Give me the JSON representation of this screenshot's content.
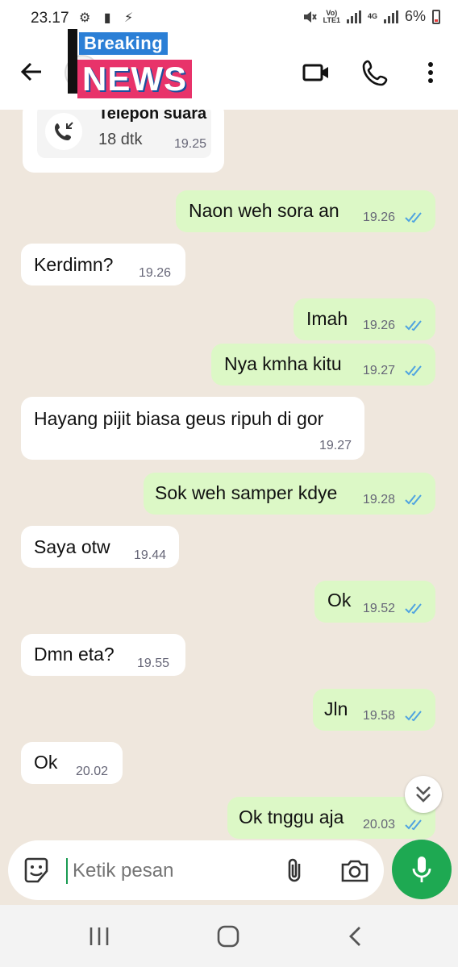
{
  "status_bar": {
    "time": "23.17",
    "left_icons": "⚙ ▮ ⚡",
    "network_lte": "LTE1",
    "network_volte": "Vo)",
    "network_4g": "4G",
    "battery": "6%"
  },
  "header": {
    "overlay_logo": {
      "top": "Breaking",
      "bottom": "NEWS"
    },
    "icons": [
      "back-arrow-icon",
      "video-call-icon",
      "phone-icon",
      "more-vert-icon"
    ]
  },
  "call_log": {
    "title": "Telepon suara",
    "duration": "18 dtk",
    "time": "19.25"
  },
  "messages": [
    {
      "dir": "out",
      "text": "Naon weh sora an",
      "time": "19.26"
    },
    {
      "dir": "in",
      "text": "Kerdimn?",
      "time": "19.26"
    },
    {
      "dir": "out",
      "text": "Imah",
      "time": "19.26"
    },
    {
      "dir": "out",
      "text": "Nya kmha kitu",
      "time": "19.27"
    },
    {
      "dir": "in",
      "text": "Hayang pijit biasa geus ripuh di gor",
      "time": "19.27"
    },
    {
      "dir": "out",
      "text": "Sok weh samper kdye",
      "time": "19.28"
    },
    {
      "dir": "in",
      "text": "Saya otw",
      "time": "19.44"
    },
    {
      "dir": "out",
      "text": "Ok",
      "time": "19.52"
    },
    {
      "dir": "in",
      "text": "Dmn eta?",
      "time": "19.55"
    },
    {
      "dir": "out",
      "text": "Jln",
      "time": "19.58"
    },
    {
      "dir": "in",
      "text": "Ok",
      "time": "20.02"
    },
    {
      "dir": "out",
      "text": "Ok tnggu aja",
      "time": "20.03"
    }
  ],
  "composer": {
    "placeholder": "Ketik pesan"
  },
  "colors": {
    "accent": "#1ea952",
    "outgoing_bubble": "#dcf8c6",
    "incoming_bubble": "#ffffff",
    "wallpaper": "#efe7dd",
    "read_ticks": "#4fa3e0"
  }
}
